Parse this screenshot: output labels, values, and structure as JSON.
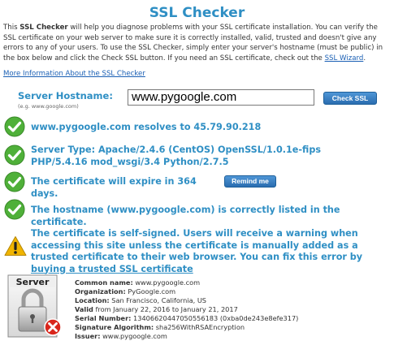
{
  "title": "SSL Checker",
  "intro": {
    "p1": "This ",
    "p1_bold": "SSL Checker",
    "p2": " will help you diagnose problems with your SSL certificate installation. You can verify the SSL certificate on your web server to make sure it  is correctly installed, valid, trusted and doesn't give any errors to any of your users. To use the SSL Checker, simply enter your server's hostname (must be public) in the box below and click the Check SSL button. If you need an SSL certificate, check out the ",
    "wizard_link": "SSL Wizard",
    "p3": "."
  },
  "more_info_link": "More Information About the SSL Checker",
  "hostname": {
    "label": "Server Hostname:",
    "example": "(e.g. www.google.com)",
    "value": "www.pygoogle.com"
  },
  "check_button": "Check SSL",
  "results": {
    "resolves": "www.pygoogle.com resolves to 45.79.90.218",
    "server_type": "Server Type: Apache/2.4.6 (CentOS) OpenSSL/1.0.1e-fips PHP/5.4.16 mod_wsgi/3.4 Python/2.7.5",
    "expire": "The certificate will expire in 364 days.",
    "remind_button": "Remind me",
    "hostname_listed": "The hostname (www.pygoogle.com) is correctly listed in the certificate.",
    "self_signed": "The certificate is self-signed. Users will receive a warning when accessing this site unless the certificate is manually added as a trusted certificate to their web browser. You can fix this error by ",
    "self_signed_link": "buying a trusted SSL certificate"
  },
  "server_icon_label": "Server",
  "cert": {
    "common_name_label": "Common name:",
    "common_name": "www.pygoogle.com",
    "org_label": "Organization:",
    "org": "PyGoogle.com",
    "location_label": "Location:",
    "location": "San Francisco, California, US",
    "valid_label": "Valid",
    "valid": "from January 22, 2016 to January 21, 2017",
    "serial_label": "Serial Number:",
    "serial": "13406620447050556183 (0xba0de243e8efe317)",
    "sigalg_label": "Signature Algorithm:",
    "sigalg": "sha256WithRSAEncryption",
    "issuer_label": "Issuer:",
    "issuer": "www.pygoogle.com"
  },
  "colors": {
    "accent": "#2f8fc4",
    "success": "#4fb039",
    "warning": "#f0b400",
    "error": "#d9261c"
  }
}
